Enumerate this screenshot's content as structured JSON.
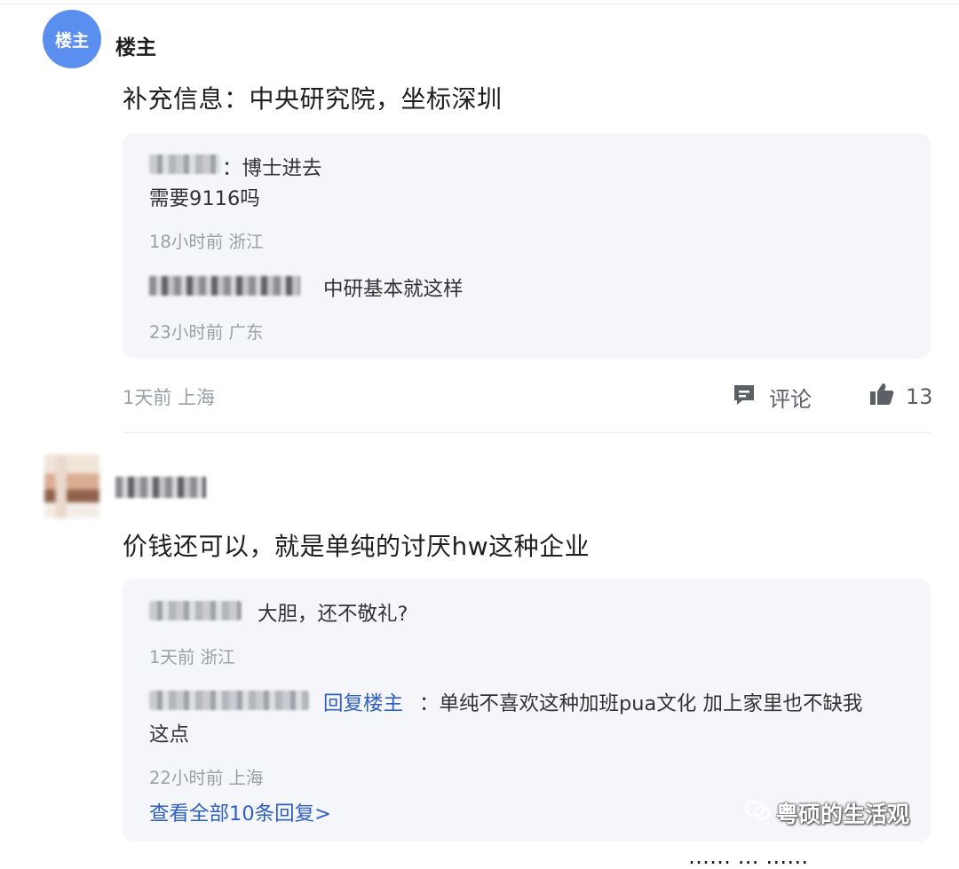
{
  "post1": {
    "avatar_text": "楼主",
    "username": "楼主",
    "text": "补充信息：中央研究院，坐标深圳",
    "replies": [
      {
        "text": "：博士进去",
        "text_line2": "需要9116吗",
        "meta": "18小时前 浙江"
      },
      {
        "text": "中研基本就这样",
        "meta": "23小时前 广东"
      }
    ],
    "meta": "1天前 上海",
    "comment_label": "评论",
    "like_count": "13"
  },
  "post2": {
    "text": "价钱还可以，就是单纯的讨厌hw这种企业",
    "replies": [
      {
        "text": "大胆，还不敬礼?",
        "meta": "1天前 浙江"
      },
      {
        "reply_to": "回复楼主",
        "text": "：单纯不喜欢这种加班pua文化 加上家里也不缺我",
        "text_line2": "这点",
        "meta": "22小时前 上海"
      }
    ],
    "view_all": "查看全部10条回复>"
  },
  "watermark": "粤硕的生活观",
  "cut_off_text": "…… … ……"
}
